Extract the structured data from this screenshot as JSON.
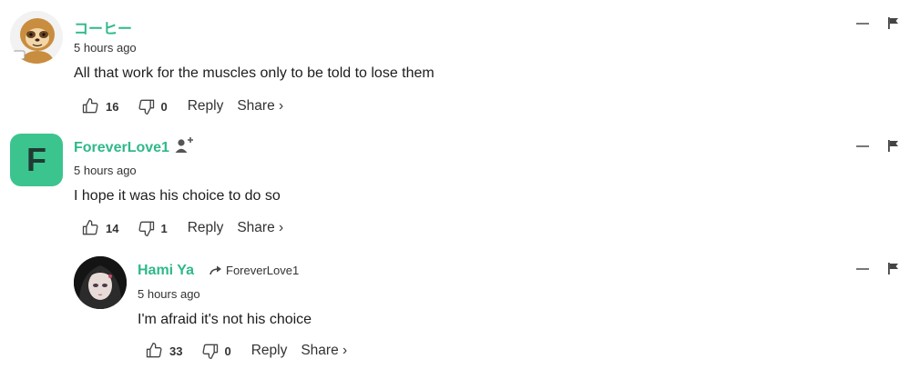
{
  "comments": [
    {
      "author": "コーヒー",
      "time": "5 hours ago",
      "text": "All that work for the muscles only to be told to lose them",
      "likes": "16",
      "dislikes": "0",
      "reply_label": "Reply",
      "share_label": "Share ›",
      "avatar": "sloth-avatar"
    },
    {
      "author": "ForeverLove1",
      "avatar_letter": "F",
      "avatar_color": "#3cc48e",
      "time": "5 hours ago",
      "text": "I hope it was his choice to do so",
      "likes": "14",
      "dislikes": "1",
      "reply_label": "Reply",
      "share_label": "Share ›"
    },
    {
      "author": "Hami Ya",
      "reply_to": "ForeverLove1",
      "time": "5 hours ago",
      "text": "I'm afraid it's not his choice",
      "likes": "33",
      "dislikes": "0",
      "reply_label": "Reply",
      "share_label": "Share ›",
      "avatar": "anime-girl-avatar"
    }
  ],
  "colors": {
    "author_green": "#2fb98a",
    "text": "#1d1d1d",
    "muted": "#333333"
  }
}
